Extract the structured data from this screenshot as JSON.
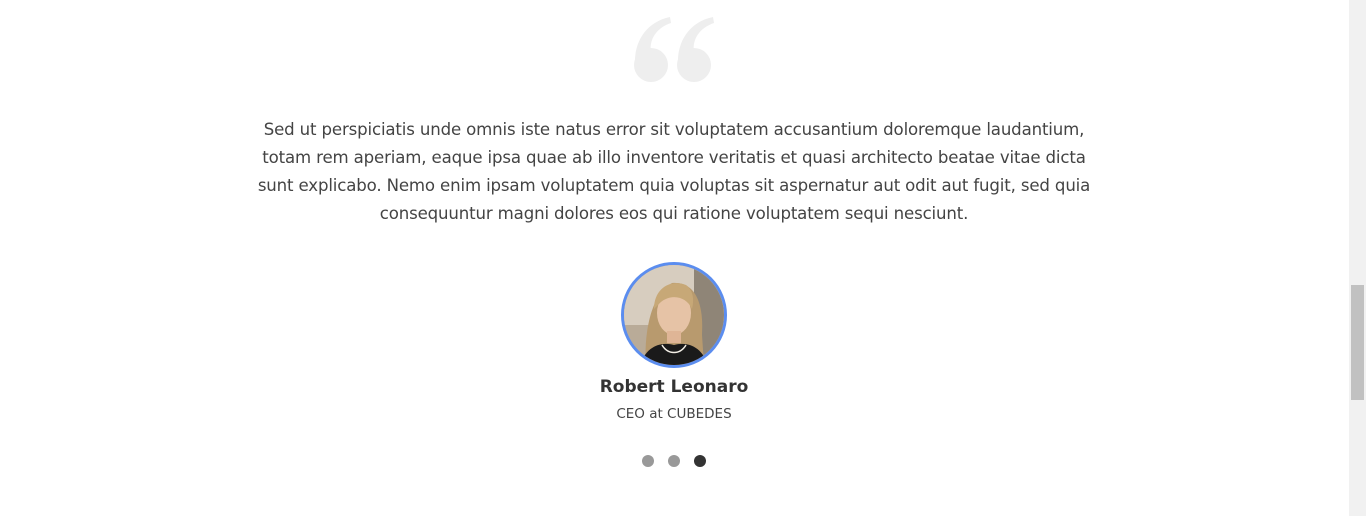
{
  "testimonial": {
    "quote_icon": "quote-mark-icon",
    "text": "Sed ut perspiciatis unde omnis iste natus error sit voluptatem accusantium doloremque laudantium, totam rem aperiam, eaque ipsa quae ab illo inventore veritatis et quasi architecto beatae vitae dicta sunt explicabo. Nemo enim ipsam voluptatem quia voluptas sit aspernatur aut odit aut fugit, sed quia consequuntur magni dolores eos qui ratione voluptatem sequi nesciunt.",
    "author_name": "Robert Leonaro",
    "author_role": "CEO at CUBEDES"
  },
  "carousel": {
    "slide_count": 3,
    "active_index": 2
  },
  "colors": {
    "avatar_border": "#5b8def",
    "dot_inactive": "#999999",
    "dot_active": "#333333",
    "quote_mark": "#eeeeee"
  }
}
